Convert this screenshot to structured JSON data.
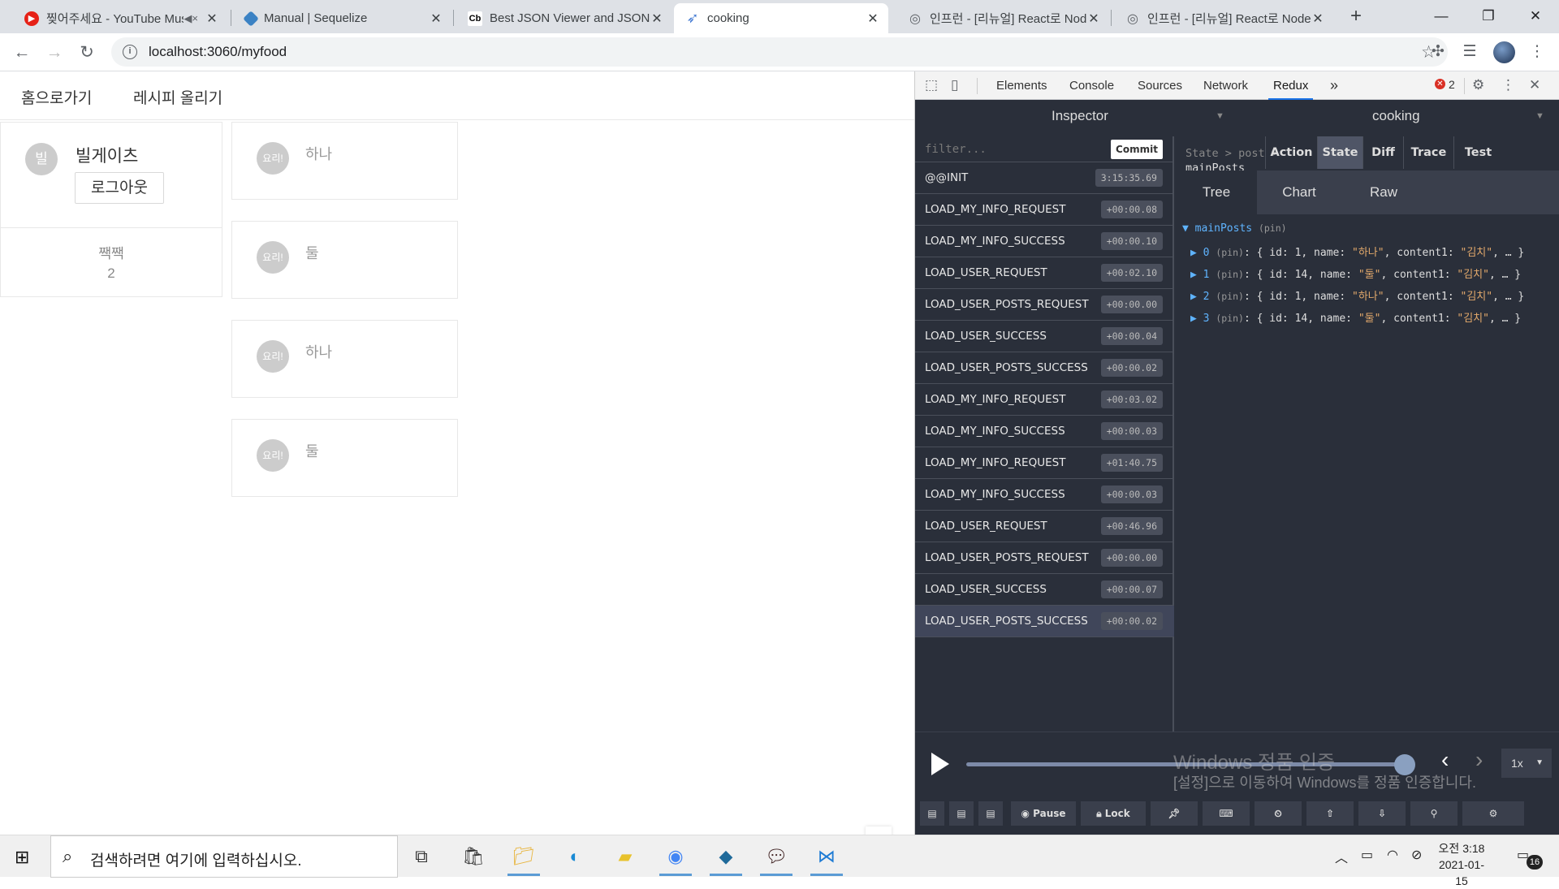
{
  "browser": {
    "tabs": [
      {
        "title": "찢어주세요 - YouTube Music",
        "icon": "youtube-music-icon"
      },
      {
        "title": "Manual | Sequelize",
        "icon": "sequelize-icon"
      },
      {
        "title": "Best JSON Viewer and JSON Beautifier",
        "icon": "codebeautify-icon"
      },
      {
        "title": "cooking",
        "icon": "feather-icon"
      },
      {
        "title": "인프런 - [리뉴얼] React로 NodeBird",
        "icon": "inflearn-icon"
      },
      {
        "title": "인프런 - [리뉴얼] React로 NodeBird",
        "icon": "inflearn-icon"
      }
    ],
    "favicons": {
      "tab1": "▶",
      "tab3": "Cb",
      "tab5": "◎",
      "tab6": "◎"
    },
    "url": "localhost:3060/myfood"
  },
  "page": {
    "menu": {
      "home": "홈으로가기",
      "upload": "레시피 올리기"
    },
    "profile": {
      "avatar": "빌",
      "name": "빌게이츠",
      "logout": "로그아웃",
      "stat_label": "짹짹",
      "stat_value": "2"
    },
    "posts": [
      {
        "avatar": "요리!",
        "name": "하나"
      },
      {
        "avatar": "요리!",
        "name": "둘"
      },
      {
        "avatar": "요리!",
        "name": "하나"
      },
      {
        "avatar": "요리!",
        "name": "둘"
      }
    ]
  },
  "devtools": {
    "tabs": [
      "Elements",
      "Console",
      "Sources",
      "Network",
      "Redux"
    ],
    "more": "»",
    "error_count": "2",
    "redux": {
      "inspector_label": "Inspector",
      "instance_label": "cooking",
      "filter_placeholder": "filter...",
      "commit": "Commit",
      "actions": [
        {
          "name": "@@INIT",
          "time": "3:15:35.69"
        },
        {
          "name": "LOAD_MY_INFO_REQUEST",
          "time": "+00:00.08"
        },
        {
          "name": "LOAD_MY_INFO_SUCCESS",
          "time": "+00:00.10"
        },
        {
          "name": "LOAD_USER_REQUEST",
          "time": "+00:02.10"
        },
        {
          "name": "LOAD_USER_POSTS_REQUEST",
          "time": "+00:00.00"
        },
        {
          "name": "LOAD_USER_SUCCESS",
          "time": "+00:00.04"
        },
        {
          "name": "LOAD_USER_POSTS_SUCCESS",
          "time": "+00:00.02"
        },
        {
          "name": "LOAD_MY_INFO_REQUEST",
          "time": "+00:03.02"
        },
        {
          "name": "LOAD_MY_INFO_SUCCESS",
          "time": "+00:00.03"
        },
        {
          "name": "LOAD_MY_INFO_REQUEST",
          "time": "+01:40.75"
        },
        {
          "name": "LOAD_MY_INFO_SUCCESS",
          "time": "+00:00.03"
        },
        {
          "name": "LOAD_USER_REQUEST",
          "time": "+00:46.96"
        },
        {
          "name": "LOAD_USER_POSTS_REQUEST",
          "time": "+00:00.00"
        },
        {
          "name": "LOAD_USER_SUCCESS",
          "time": "+00:00.07"
        },
        {
          "name": "LOAD_USER_POSTS_SUCCESS",
          "time": "+00:00.02"
        }
      ],
      "selected_action": 14,
      "breadcrumb": {
        "a": "State",
        "sep": ">",
        "b": "post",
        "c": "mainPosts"
      },
      "state_buttons": [
        "Action",
        "State",
        "Diff",
        "Trace",
        "Test"
      ],
      "state_selected": "State",
      "view_tabs": [
        "Tree",
        "Chart",
        "Raw"
      ],
      "view_selected": "Tree",
      "tree": {
        "root": "mainPosts",
        "pin": "(pin)",
        "items": [
          {
            "idx": "0",
            "id": "1",
            "name": "\"하나\"",
            "content": "\"김치\""
          },
          {
            "idx": "1",
            "id": "14",
            "name": "\"둘\"",
            "content": "\"김치\""
          },
          {
            "idx": "2",
            "id": "1",
            "name": "\"하나\"",
            "content": "\"김치\""
          },
          {
            "idx": "3",
            "id": "14",
            "name": "\"둘\"",
            "content": "\"김치\""
          }
        ]
      },
      "speed": "1x",
      "bottom_buttons": {
        "pause": "Pause",
        "lock": "Lock"
      }
    },
    "watermark": {
      "line1": "Windows 정품 인증",
      "line2": "[설정]으로 이동하여 Windows를 정품 인증합니다."
    }
  },
  "taskbar": {
    "search_placeholder": "검색하려면 여기에 입력하십시오.",
    "time": "오전 3:18",
    "date": "2021-01-15",
    "notifications": "16"
  },
  "colors": {
    "accent": "#1a73e8",
    "redux_bg": "#2a2f3a",
    "tree_key": "#5fb4ff",
    "tree_string": "#e3a96b"
  }
}
